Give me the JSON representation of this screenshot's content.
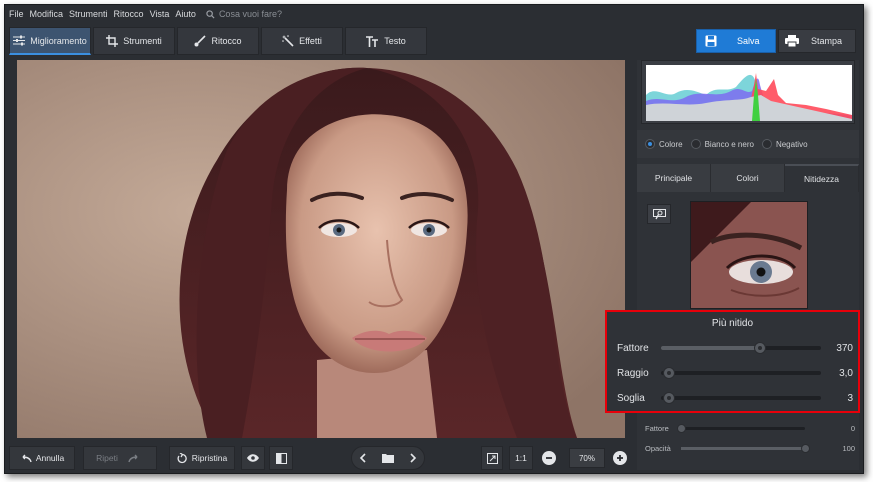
{
  "menu": {
    "items": [
      "File",
      "Modifica",
      "Strumenti",
      "Ritocco",
      "Vista",
      "Aiuto"
    ],
    "search_placeholder": "Cosa vuoi fare?"
  },
  "toolbar": {
    "tabs": [
      {
        "label": "Miglioramento",
        "icon": "sliders-icon",
        "active": true
      },
      {
        "label": "Strumenti",
        "icon": "crop-icon",
        "active": false
      },
      {
        "label": "Ritocco",
        "icon": "brush-icon",
        "active": false
      },
      {
        "label": "Effetti",
        "icon": "magic-wand-icon",
        "active": false
      },
      {
        "label": "Testo",
        "icon": "text-icon",
        "active": false
      }
    ],
    "save_label": "Salva",
    "print_label": "Stampa"
  },
  "panel": {
    "color_modes": [
      {
        "label": "Colore",
        "selected": true
      },
      {
        "label": "Bianco e nero",
        "selected": false
      },
      {
        "label": "Negativo",
        "selected": false
      }
    ],
    "tabs": [
      {
        "label": "Principale",
        "active": false
      },
      {
        "label": "Colori",
        "active": false
      },
      {
        "label": "Nitidezza",
        "active": true
      }
    ],
    "sharpen": {
      "title": "Più nitido",
      "sliders": [
        {
          "label": "Fattore",
          "value": "370",
          "position": 0.62
        },
        {
          "label": "Raggio",
          "value": "3,0",
          "position": 0.05
        },
        {
          "label": "Soglia",
          "value": "3",
          "position": 0.05
        }
      ]
    },
    "extra_sliders": [
      {
        "label": "Fattore",
        "value": "0",
        "position": 0.0
      },
      {
        "label": "Opacità",
        "value": "100",
        "position": 1.0
      }
    ]
  },
  "bottombar": {
    "undo_label": "Annulla",
    "redo_label": "Ripeti",
    "reset_label": "Ripristina",
    "ratio_label": "1:1",
    "zoom_value": "70%"
  },
  "colors": {
    "accent": "#1f7bd6",
    "highlight_border": "#e8000a",
    "panel_bg": "#2b2e33"
  }
}
